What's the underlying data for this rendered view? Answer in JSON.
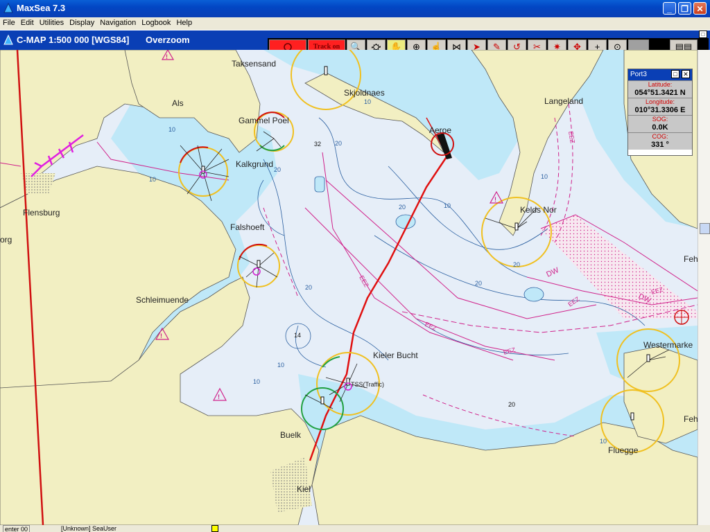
{
  "window": {
    "title": "MaxSea 7.3"
  },
  "menu": [
    "File",
    "Edit",
    "Utilities",
    "Display",
    "Navigation",
    "Logbook",
    "Help"
  ],
  "chart_header": {
    "title": "C-MAP  1:500 000 [WGS84]",
    "mode": "Overzoom"
  },
  "toolbar": {
    "track_label": "Track on"
  },
  "info_panel": {
    "title": "Port3",
    "latitude_label": "Latitude:",
    "latitude": "054°51.3421 N",
    "longitude_label": "Longitude:",
    "longitude": "010°31.3306 E",
    "sog_label": "SOG:",
    "sog": "0.0K",
    "cog_label": "COG:",
    "cog": "331 °"
  },
  "places": {
    "taksensand": "Taksensand",
    "als": "Als",
    "skjoldnaes": "Skjoldnaes",
    "aeroe": "Aeroe",
    "langeland": "Langeland",
    "gammel_poel": "Gammel Poel",
    "kalkgrund": "Kalkgrund",
    "flensburg": "Flensburg",
    "org": "org",
    "falshoeft": "Falshoeft",
    "keld_nor": "Kelds Nor",
    "feh_top": "Feh",
    "schleimuende": "Schleimuende",
    "kieler_bucht": "Kieler Bucht",
    "traffic": "TSS(Traffic)",
    "westermarke": "Westermarke",
    "buelk": "Buelk",
    "feh_bottom": "Feh",
    "fluegge": "Fluegge",
    "kiel": "Kiel"
  },
  "depths": {
    "d32": "32",
    "d14": "14",
    "d20": "20",
    "d10": "10"
  },
  "zone_labels": {
    "eez": "EEZ",
    "dw": "DW"
  },
  "statusbar": {
    "left": "enter 00",
    "user": "[Unknown] SeaUser"
  },
  "colors": {
    "land": "#f2efc2",
    "shallow": "#bfe8f8",
    "deep": "#e6eef8",
    "track": "#e01010",
    "zone": "#d0208a"
  }
}
